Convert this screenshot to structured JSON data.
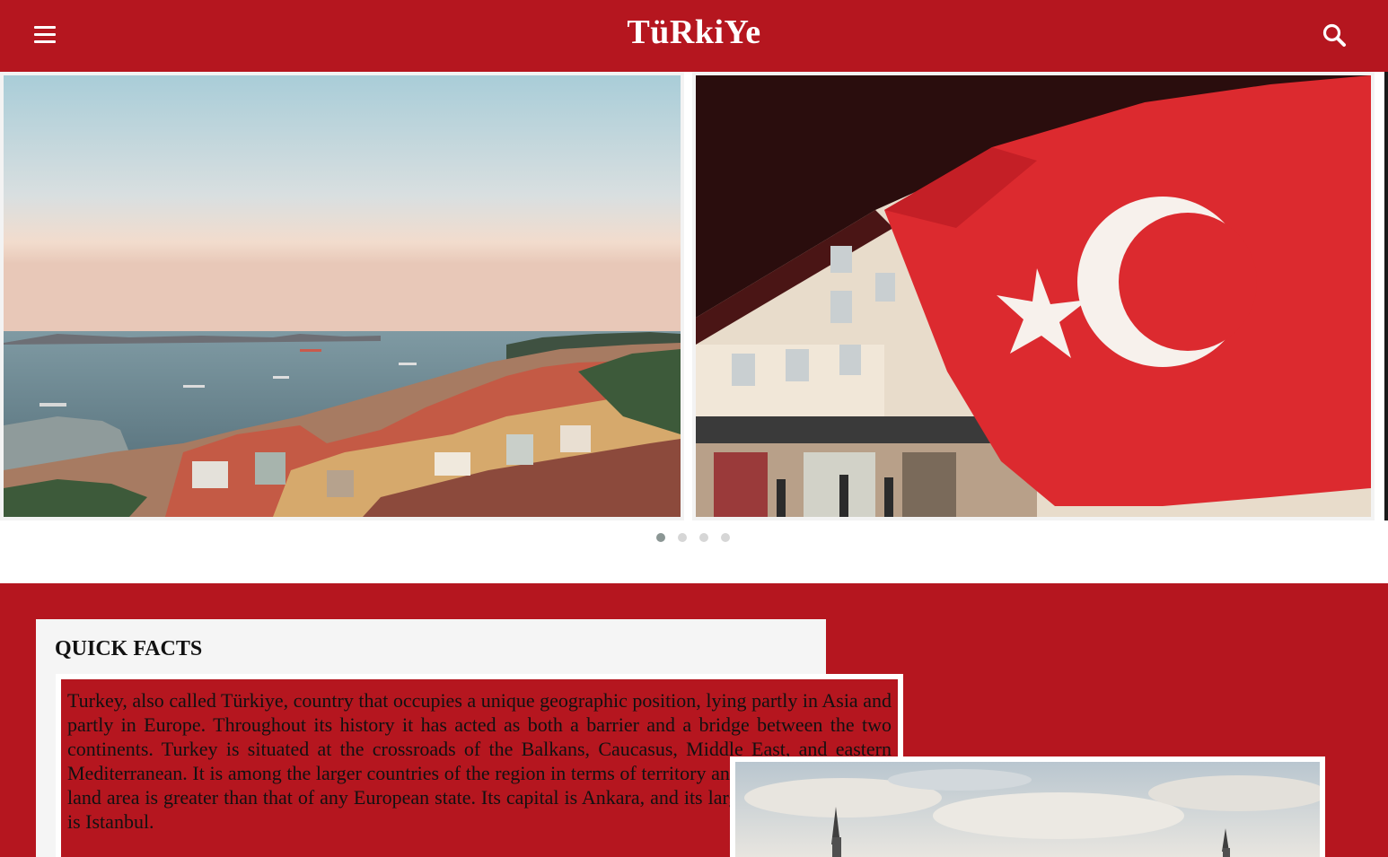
{
  "header": {
    "brand": "TüRkiYe",
    "menu_icon": "hamburger-menu-icon",
    "search_icon": "search-icon",
    "background_color": "#b5161f"
  },
  "slider": {
    "slides": [
      {
        "image": "istanbul-bosphorus-rooftops-photo"
      },
      {
        "image": "turkish-flag-street-photo"
      },
      {
        "image": "partial-next-slide-photo"
      }
    ],
    "dots": [
      {
        "active": true
      },
      {
        "active": false
      },
      {
        "active": false
      },
      {
        "active": false
      }
    ],
    "active_dot_color": "#8b9694",
    "inactive_dot_color": "#d6d6d6"
  },
  "quick_facts": {
    "title": "QUICK FACTS",
    "text": "Turkey, also called Türkiye, country that occupies a unique geographic position, lying partly in Asia and partly in Europe. Throughout its history it has acted as both a barrier and a bridge between the two continents. Turkey is situated at the crossroads of the Balkans, Caucasus, Middle East, and eastern Mediterranean. It is among the larger countries of the region in terms of territory and population, and its land area is greater than that of any European state. Its capital is Ankara, and its largest city and seaport is Istanbul.",
    "photo": "mosque-minarets-cloudy-sky-photo"
  },
  "colors": {
    "accent_red": "#b5161f",
    "card_background": "#f5f5f5"
  }
}
